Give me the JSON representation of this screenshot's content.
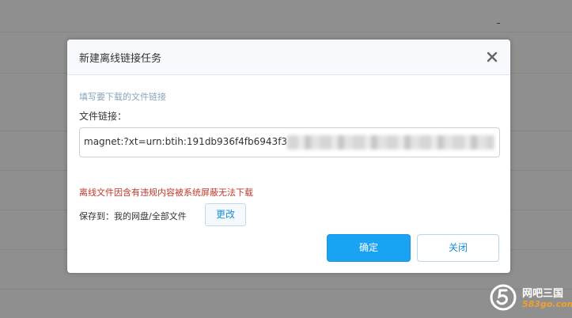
{
  "dialog": {
    "title": "新建离线链接任务",
    "hint": "填写要下载的文件链接",
    "field_label": "文件链接：",
    "link_value": "magnet:?xt=urn:btih:191db936f4fb6943f3",
    "error_text": "离线文件因含有违规内容被系统屏蔽无法下载",
    "save_to_label": "保存到：我的网盘/全部文件",
    "change_label": "更改",
    "confirm_label": "确定",
    "close_label": "关闭",
    "close_icon": "close-icon"
  },
  "watermark": {
    "name": "网吧三国",
    "url": "583go.com"
  },
  "colors": {
    "primary": "#1aa3f2",
    "error": "#c0392b",
    "link": "#1a8fd6"
  }
}
